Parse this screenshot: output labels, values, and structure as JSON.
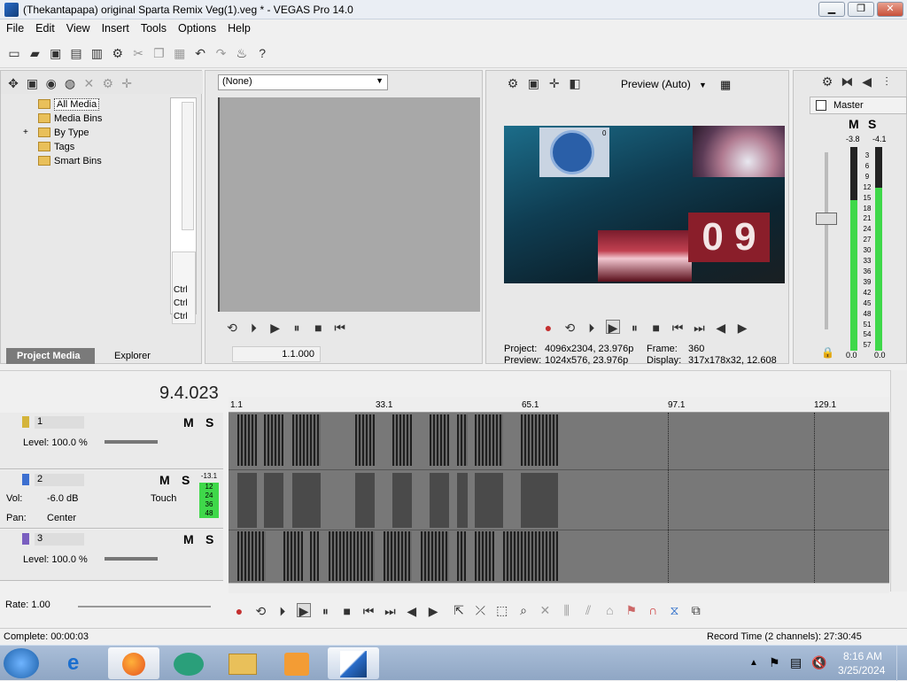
{
  "window": {
    "title": "(Thekantapapa) original Sparta Remix Veg(1).veg * - VEGAS Pro 14.0"
  },
  "menu": [
    "File",
    "Edit",
    "View",
    "Insert",
    "Tools",
    "Options",
    "Help"
  ],
  "project_media": {
    "tree": [
      "All Media",
      "Media Bins",
      "By Type",
      "Tags",
      "Smart Bins"
    ],
    "expander": "+",
    "tabs": [
      "Project Media",
      "Explorer"
    ]
  },
  "trimmer": {
    "dropdown": "(None)",
    "time": "1.1.000"
  },
  "shortcuts": [
    "Ctrl",
    "Ctrl",
    "Ctrl"
  ],
  "preview": {
    "mode": "Preview (Auto)",
    "project_label": "Project:",
    "project_value": "4096x2304, 23.976p",
    "frame_label": "Frame:",
    "frame_value": "360",
    "preview_label": "Preview:",
    "preview_value": "1024x576, 23.976p",
    "display_label": "Display:",
    "display_value": "317x178x32, 12.608",
    "clock_label": "0",
    "overlay_digits": "0 9"
  },
  "master": {
    "title": "Master",
    "m": "M",
    "s": "S",
    "left_db": "-3.8",
    "right_db": "-4.1",
    "scale": [
      "3",
      "6",
      "9",
      "12",
      "15",
      "18",
      "21",
      "24",
      "27",
      "30",
      "33",
      "36",
      "39",
      "42",
      "45",
      "48",
      "51",
      "54",
      "57"
    ],
    "bottom_left": "0.0",
    "bottom_right": "0.0",
    "left_level": 0.74,
    "right_level": 0.8
  },
  "timeline": {
    "time": "9.4.023",
    "ruler": [
      "1.1",
      "33.1",
      "65.1",
      "97.1",
      "129.1"
    ],
    "tracks": [
      {
        "num": "1",
        "level": "Level: 100.0 %",
        "m": "M",
        "s": "S"
      },
      {
        "num": "2",
        "vol_label": "Vol:",
        "vol": "-6.0 dB",
        "pan_label": "Pan:",
        "pan": "Center",
        "auto": "Touch",
        "m": "M",
        "s": "S",
        "meter_top": "-13.1",
        "meter": [
          "12",
          "24",
          "36",
          "48"
        ]
      },
      {
        "num": "3",
        "level": "Level: 100.0 %",
        "m": "M",
        "s": "S"
      }
    ],
    "rate": "Rate: 1.00"
  },
  "status": {
    "complete": "Complete: 00:00:03",
    "record": "Record Time (2 channels): 27:30:45"
  },
  "taskbar": {
    "time": "8:16 AM",
    "date": "3/25/2024"
  },
  "colors": {
    "vegas_blue": "#2a6cc9",
    "meter_green": "#3fd84a",
    "timeline_dark": "#4a4a4a",
    "track1": "#d4b43a",
    "track2": "#3c6fd0",
    "track3": "#7a5fc0"
  }
}
